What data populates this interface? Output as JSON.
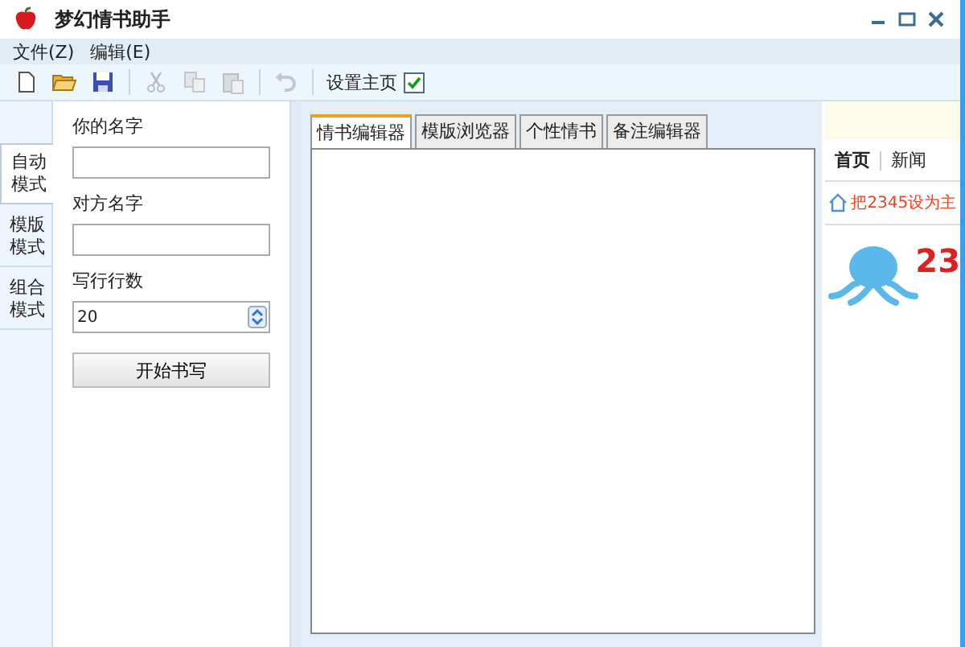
{
  "window": {
    "title": "梦幻情书助手"
  },
  "menu": [
    "文件(Z)",
    "编辑(E)"
  ],
  "toolbar": {
    "items": [
      {
        "kind": "new",
        "disabled": false
      },
      {
        "kind": "open",
        "disabled": false
      },
      {
        "kind": "save",
        "disabled": false
      },
      {
        "kind": "sep"
      },
      {
        "kind": "cut",
        "disabled": true
      },
      {
        "kind": "copy",
        "disabled": true
      },
      {
        "kind": "paste",
        "disabled": true
      },
      {
        "kind": "sep"
      },
      {
        "kind": "undo",
        "disabled": true
      },
      {
        "kind": "sep"
      }
    ],
    "homepage": {
      "label": "设置主页",
      "checked": true
    }
  },
  "side_tabs": [
    {
      "label": "自动模式",
      "selected": true
    },
    {
      "label": "模版模式",
      "selected": false
    },
    {
      "label": "组合模式",
      "selected": false
    }
  ],
  "form": {
    "fields": [
      {
        "label": "你的名字",
        "kind": "text"
      },
      {
        "label": "对方名字",
        "kind": "text"
      },
      {
        "label": "写行行数",
        "kind": "spin",
        "value": "20"
      }
    ],
    "button": "开始书写"
  },
  "tabs": [
    {
      "label": "情书编辑器",
      "selected": true
    },
    {
      "label": "模版浏览器",
      "selected": false
    },
    {
      "label": "个性情书",
      "selected": false
    },
    {
      "label": "备注编辑器",
      "selected": false
    }
  ],
  "web": {
    "nav": [
      "首页",
      "新闻"
    ],
    "link": "把2345设为主",
    "logo_text": "23"
  }
}
